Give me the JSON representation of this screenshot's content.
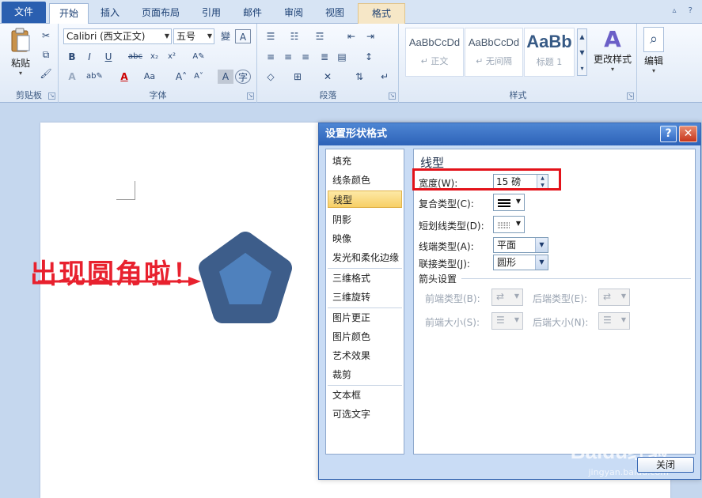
{
  "tabs": [
    {
      "label": "文件",
      "cls": "file"
    },
    {
      "label": "开始",
      "cls": "active"
    },
    {
      "label": "插入",
      "cls": ""
    },
    {
      "label": "页面布局",
      "cls": ""
    },
    {
      "label": "引用",
      "cls": ""
    },
    {
      "label": "邮件",
      "cls": ""
    },
    {
      "label": "审阅",
      "cls": ""
    },
    {
      "label": "视图",
      "cls": ""
    },
    {
      "label": "格式",
      "cls": "ctx"
    }
  ],
  "ribbon": {
    "clipboard": {
      "label": "剪贴板",
      "paste": "粘贴"
    },
    "font": {
      "label": "字体",
      "font_name": "Calibri (西文正文)",
      "font_size": "五号"
    },
    "paragraph": {
      "label": "段落"
    },
    "styles": {
      "label": "样式",
      "items": [
        {
          "sample": "AaBbCcDd",
          "name": "↵ 正文"
        },
        {
          "sample": "AaBbCcDd",
          "name": "↵ 无间隔"
        },
        {
          "sample": "AaBb",
          "name": "标题 1"
        }
      ],
      "change": "更改样式"
    },
    "editing": {
      "label": "编辑"
    }
  },
  "annotation": "出现圆角啦！",
  "colors": {
    "accent": "#2a5fb0",
    "pentagon_outer": "#3d5d8a",
    "pentagon_inner": "#4f81bd",
    "highlight": "#e3121a",
    "annotation": "#e8212e"
  },
  "dialog": {
    "title": "设置形状格式",
    "help": "?",
    "close_x": "✕",
    "nav": [
      "填充",
      "线条颜色",
      "线型",
      "阴影",
      "映像",
      "发光和柔化边缘",
      "三维格式",
      "三维旋转",
      "图片更正",
      "图片颜色",
      "艺术效果",
      "裁剪",
      "文本框",
      "可选文字"
    ],
    "selected_nav": "线型",
    "panel": {
      "title": "线型",
      "width_label": "宽度(W):",
      "width_value": "15 磅",
      "compound_label": "复合类型(C):",
      "dash_label": "短划线类型(D):",
      "cap_label": "线端类型(A):",
      "cap_value": "平面",
      "join_label": "联接类型(J):",
      "join_value": "圆形",
      "arrow_group": "箭头设置",
      "begin_type": "前端类型(B):",
      "end_type": "后端类型(E):",
      "begin_size": "前端大小(S):",
      "end_size": "后端大小(N):"
    },
    "close_button": "关闭"
  },
  "watermark": {
    "brand": "Baidu经验",
    "url": "jingyan.baidu.com"
  }
}
